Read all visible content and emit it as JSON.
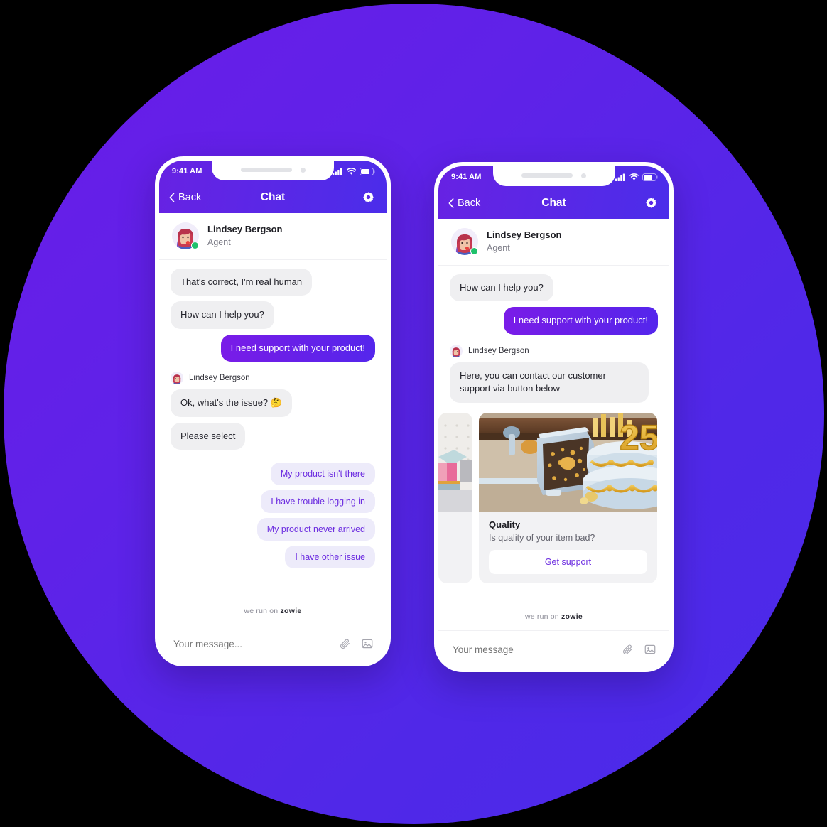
{
  "background": {
    "circle_color": "#5028E8"
  },
  "colors": {
    "brand_purple": "#6B2BE0",
    "header_gradient_start": "#6722E3",
    "header_gradient_end": "#4B2DEA",
    "user_bubble": "#6A1FE8",
    "agent_bubble": "#EFEFF1",
    "chip_bg": "#EDEBFA",
    "online_green": "#1FC16B"
  },
  "phones": [
    {
      "id": "left",
      "status_bar": {
        "time": "9:41 AM",
        "icons": [
          "signal-icon",
          "wifi-icon",
          "battery-icon"
        ]
      },
      "nav": {
        "back_label": "Back",
        "title": "Chat",
        "back_icon": "chevron-left-icon",
        "settings_icon": "gear-icon"
      },
      "agent": {
        "name": "Lindsey Bergson",
        "role": "Agent",
        "status": "online"
      },
      "messages": [
        {
          "from": "agent",
          "text": "That's correct, I'm real human"
        },
        {
          "from": "agent",
          "text": "How can I help you?"
        },
        {
          "from": "user",
          "text": "I need support with your product!"
        },
        {
          "from": "sender_label",
          "text": "Lindsey Bergson"
        },
        {
          "from": "agent",
          "text": "Ok, what's the issue? 🤔"
        },
        {
          "from": "agent",
          "text": "Please select"
        }
      ],
      "quick_replies": [
        "My product isn't there",
        "I have trouble logging in",
        "My product never arrived",
        "I have other issue"
      ],
      "branding": {
        "prefix": "we run on ",
        "brand": "zowie"
      },
      "composer": {
        "placeholder": "Your message...",
        "value": "",
        "attach_icon": "paperclip-icon",
        "image_icon": "image-icon"
      }
    },
    {
      "id": "right",
      "status_bar": {
        "time": "9:41 AM",
        "icons": [
          "signal-icon",
          "wifi-icon",
          "battery-icon"
        ]
      },
      "nav": {
        "back_label": "Back",
        "title": "Chat",
        "back_icon": "chevron-left-icon",
        "settings_icon": "gear-icon"
      },
      "agent": {
        "name": "Lindsey Bergson",
        "role": "Agent",
        "status": "online"
      },
      "messages": [
        {
          "from": "agent",
          "text": "How can I help you?"
        },
        {
          "from": "user",
          "text": "I need support with your product!"
        },
        {
          "from": "sender_label",
          "text": "Lindsey Bergson"
        },
        {
          "from": "agent",
          "text": "Here, you can contact our customer support via button below"
        }
      ],
      "cards": [
        {
          "title": "",
          "subtitle": "",
          "button_label": "",
          "image": "product-render-pink"
        },
        {
          "title": "Quality",
          "subtitle": "Is quality of your item bad?",
          "button_label": "Get support",
          "image": "toaster-cake-render"
        }
      ],
      "branding": {
        "prefix": "we run on ",
        "brand": "zowie"
      },
      "composer": {
        "placeholder": "Your message",
        "value": "",
        "attach_icon": "paperclip-icon",
        "image_icon": "image-icon"
      }
    }
  ]
}
